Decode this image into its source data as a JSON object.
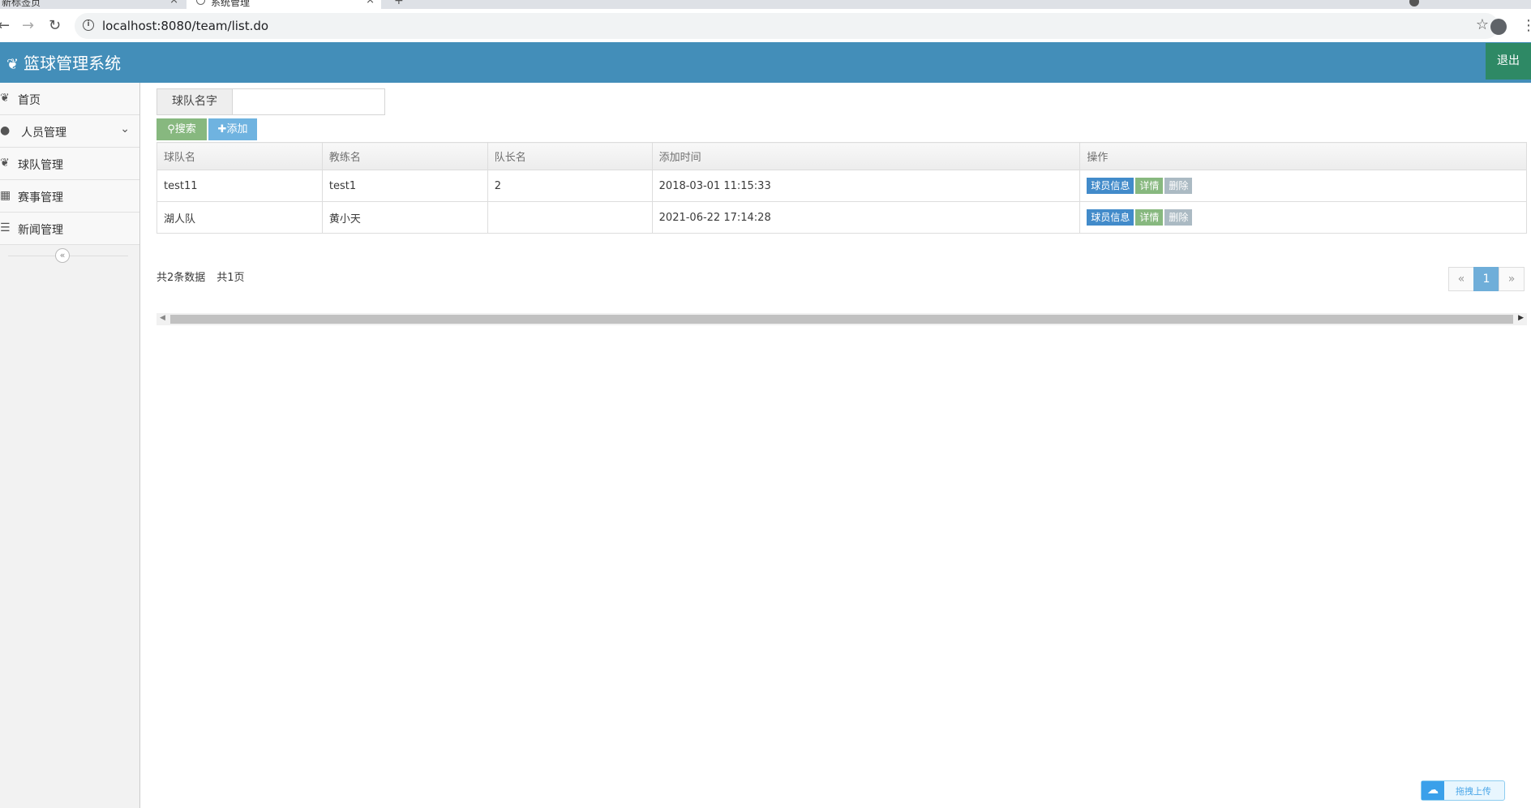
{
  "browser": {
    "tabs": [
      {
        "title": "新标签页",
        "close": "×"
      },
      {
        "title": "系统管理",
        "close": "×"
      }
    ],
    "new_tab": "+",
    "url": "localhost:8080/team/list.do",
    "back": "←",
    "forward": "→",
    "reload": "↻",
    "star": "☆",
    "menu": "⋮"
  },
  "header": {
    "brand": "篮球管理系统",
    "brand_icon": "leaf-icon",
    "logout": "退出",
    "color": "#438eb9",
    "logout_color": "#2e8965"
  },
  "sidebar": {
    "items": [
      {
        "label": "首页",
        "icon": "leaf-icon",
        "glyph": "❦"
      },
      {
        "label": "人员管理",
        "icon": "user-icon",
        "glyph": "👤",
        "caret": "⌄"
      },
      {
        "label": "球队管理",
        "icon": "leaf-icon",
        "glyph": "❦"
      },
      {
        "label": "赛事管理",
        "icon": "calendar-icon",
        "glyph": "▦"
      },
      {
        "label": "新闻管理",
        "icon": "list-icon",
        "glyph": "☰"
      }
    ],
    "collapse": "«"
  },
  "search": {
    "label": "球队名字",
    "value": "",
    "search_button": "搜索",
    "add_button": "添加"
  },
  "table": {
    "columns": [
      "球队名",
      "教练名",
      "队长名",
      "添加时间",
      "操作"
    ],
    "rows": [
      {
        "team": "test11",
        "coach": "test1",
        "captain": "2",
        "added": "2018-03-01 11:15:33"
      },
      {
        "team": "湖人队",
        "coach": "黄小天",
        "captain": "",
        "added": "2021-06-22 17:14:28"
      }
    ],
    "actions": {
      "info": "球员信息",
      "detail": "详情",
      "delete": "删除"
    }
  },
  "summary": {
    "total": "共2条数据",
    "pages": "共1页"
  },
  "pagination": {
    "prev": "«",
    "current": "1",
    "next": "»"
  },
  "upload": {
    "label": "拖拽上传"
  }
}
